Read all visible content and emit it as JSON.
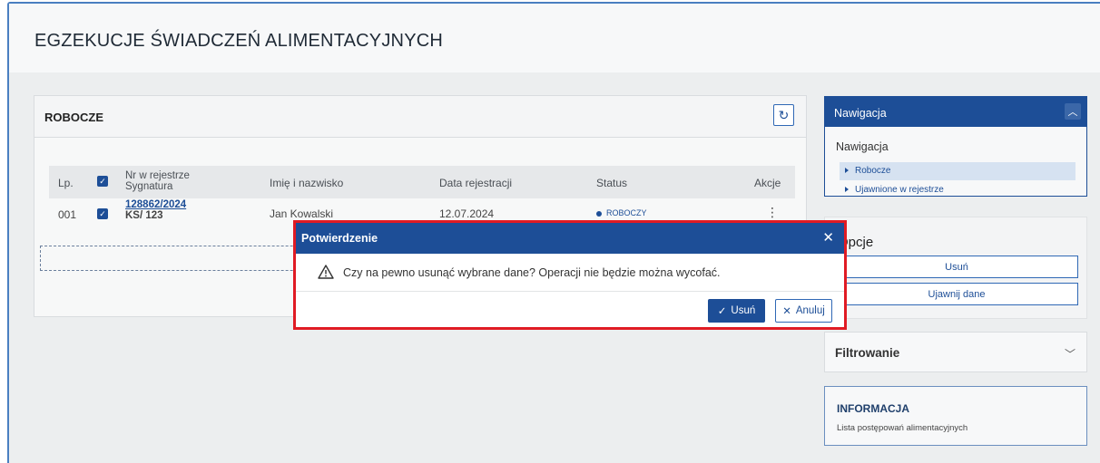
{
  "page": {
    "title": "EGZEKUCJE ŚWIADCZEŃ ALIMENTACYJNYCH"
  },
  "robocze": {
    "title": "ROBOCZE",
    "refresh_icon": "refresh-icon",
    "columns": {
      "lp": "Lp.",
      "nr_line1": "Nr w rejestrze",
      "nr_line2": "Sygnatura",
      "name": "Imię i nazwisko",
      "date": "Data rejestracji",
      "status": "Status",
      "actions": "Akcje"
    },
    "rows": [
      {
        "lp": "001",
        "nr": "128862/2024",
        "sygnatura": "KS/ 123",
        "name": "Jan Kowalski",
        "date": "12.07.2024",
        "status": "ROBOCZY",
        "actions": "⋮"
      }
    ]
  },
  "nav": {
    "header": "Nawigacja",
    "subtitle": "Nawigacja",
    "items": [
      {
        "label": "Robocze",
        "active": true
      },
      {
        "label": "Ujawnione w rejestrze",
        "active": false
      }
    ]
  },
  "opcje": {
    "title": "Opcje",
    "buttons": [
      "Usuń",
      "Ujawnij dane"
    ]
  },
  "filtr": {
    "title": "Filtrowanie"
  },
  "info": {
    "title": "INFORMACJA",
    "text": "Lista postępowań alimentacyjnych"
  },
  "dialog": {
    "title": "Potwierdzenie",
    "close": "✕",
    "message": "Czy na pewno usunąć wybrane dane? Operacji nie będzie można wycofać.",
    "confirm": "Usuń",
    "cancel": "Anuluj"
  },
  "colors": {
    "primary": "#1d4e97",
    "highlight_border": "#e01b24"
  }
}
